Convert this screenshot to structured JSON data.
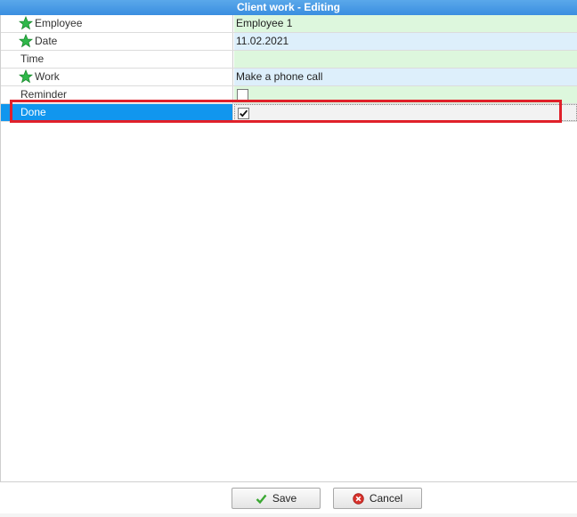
{
  "window": {
    "title": "Client work - Editing"
  },
  "fields": [
    {
      "label": "Employee",
      "value": "Employee 1",
      "required": true,
      "value_bg": "green"
    },
    {
      "label": "Date",
      "value": "11.02.2021",
      "required": true,
      "value_bg": "blue"
    },
    {
      "label": "Time",
      "value": "",
      "required": false,
      "value_bg": "green"
    },
    {
      "label": "Work",
      "value": "Make a phone call",
      "required": true,
      "value_bg": "blue"
    },
    {
      "label": "Reminder",
      "checked": false,
      "required": false,
      "value_bg": "green"
    },
    {
      "label": "Done",
      "checked": true,
      "required": false,
      "selected": true
    }
  ],
  "buttons": {
    "save_label": "Save",
    "cancel_label": "Cancel"
  },
  "colors": {
    "title_bar": "#3a8ee0",
    "selected_row": "#1196ee",
    "highlight_border": "#e0202a",
    "value_green": "#ddf7dd",
    "value_blue": "#ddeffb"
  },
  "icons": {
    "required": "star-icon",
    "save": "checkmark-icon",
    "cancel": "cancel-icon"
  }
}
